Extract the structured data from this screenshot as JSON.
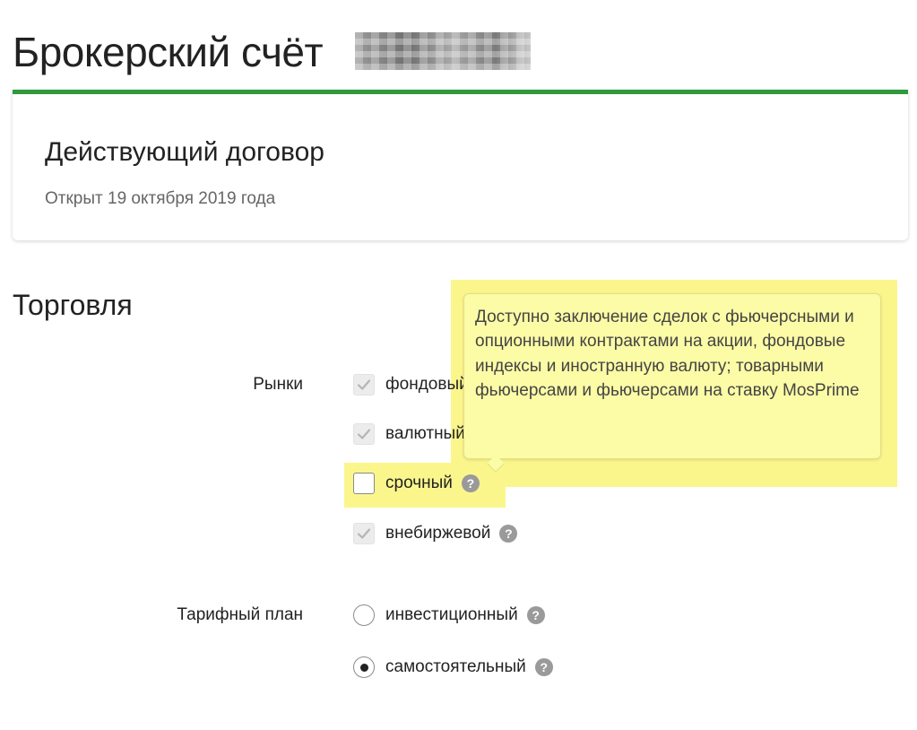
{
  "header": {
    "title": "Брокерский счёт"
  },
  "contract": {
    "title": "Действующий договор",
    "opened": "Открыт 19 октября 2019 года"
  },
  "trading": {
    "section_title": "Торговля",
    "markets_label": "Рынки",
    "markets": [
      {
        "label": "фондовый",
        "checked": true,
        "disabled": true
      },
      {
        "label": "валютный",
        "checked": true,
        "disabled": true
      },
      {
        "label": "срочный",
        "checked": false,
        "disabled": false
      },
      {
        "label": "внебиржевой",
        "checked": true,
        "disabled": true
      }
    ],
    "tariff_label": "Тарифный план",
    "tariffs": [
      {
        "label": "инвестиционный",
        "selected": false
      },
      {
        "label": "самостоятельный",
        "selected": true
      }
    ],
    "help_glyph": "?",
    "tooltip": "Доступно заключение сделок с фьючерсными и опционными контрактами на акции, фондовые индексы и иностранную валюту; товарными фьючерсами и фьючерсами на ставку MosPrime"
  },
  "colors": {
    "accent": "#2e9a3c",
    "highlight": "#fbf68c",
    "tooltip_bg": "#fcfba6",
    "help_icon": "#9a9a9a"
  }
}
